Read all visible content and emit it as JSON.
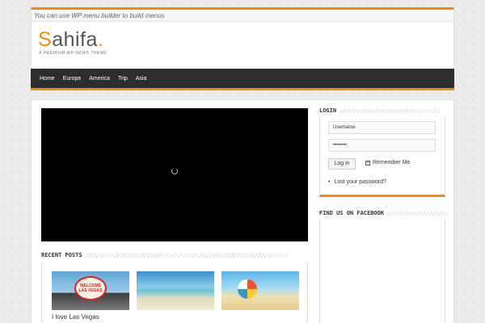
{
  "topbar": {
    "notice": "You can use WP menu builder to build menus"
  },
  "header": {
    "logo_text": "ahifa",
    "logo_first": "S",
    "logo_dot": ".",
    "tagline": "A PREMIUM WP NEWS THEME"
  },
  "nav": {
    "items": [
      "Home",
      "Europe",
      "America",
      "Trip",
      "Asia"
    ]
  },
  "recent_posts": {
    "title": "RECENT POSTS",
    "items": [
      {
        "caption": "I love Las Vegas",
        "sign_top": "WELCOME",
        "sign_main": "LAS VEGAS"
      },
      {
        "caption": ""
      },
      {
        "caption": ""
      }
    ]
  },
  "login": {
    "title": "LOGIN",
    "username_value": "Username",
    "password_value": "••••••••",
    "button_label": "Log in",
    "remember_label": "Remember Me",
    "remember_checked": true,
    "check_glyph": "✓",
    "lost_bullet": "•",
    "lost_password": "Lost your password?"
  },
  "facebook": {
    "title": "FIND US ON FACEBOOK"
  },
  "colors": {
    "accent": "#f88c00",
    "nav_bg": "#2d2d2d"
  }
}
